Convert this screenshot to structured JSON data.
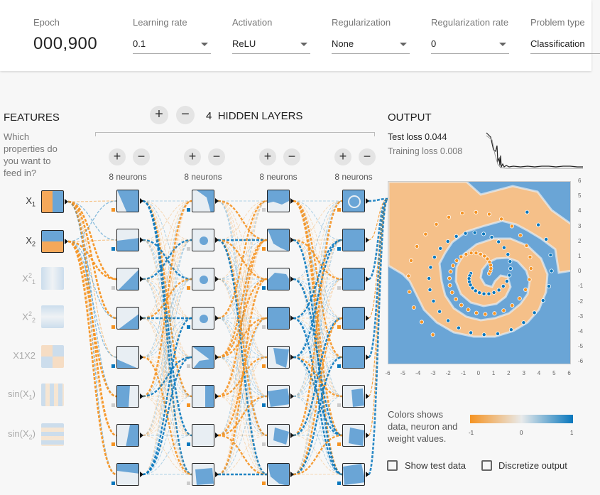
{
  "controls": {
    "epoch_label": "Epoch",
    "epoch_value": "000,900",
    "learning_rate": {
      "label": "Learning rate",
      "value": "0.1"
    },
    "activation": {
      "label": "Activation",
      "value": "ReLU"
    },
    "regularization": {
      "label": "Regularization",
      "value": "None"
    },
    "regularization_rate": {
      "label": "Regularization rate",
      "value": "0"
    },
    "problem_type": {
      "label": "Problem type",
      "value": "Classification"
    }
  },
  "features": {
    "title": "FEATURES",
    "question": [
      "Which",
      "properties do",
      "you want to",
      "feed in?"
    ],
    "items": [
      {
        "label": "X1",
        "base": "X",
        "sub": "1",
        "sup": "",
        "active": true
      },
      {
        "label": "X2",
        "base": "X",
        "sub": "2",
        "sup": "",
        "active": true
      },
      {
        "label": "X1²",
        "base": "X",
        "sub": "1",
        "sup": "2",
        "active": false
      },
      {
        "label": "X2²",
        "base": "X",
        "sub": "2",
        "sup": "2",
        "active": false
      },
      {
        "label": "X1X2",
        "base": "X1X2",
        "sub": "",
        "sup": "",
        "active": false
      },
      {
        "label": "sin(X1)",
        "base": "sin(X",
        "sub": "1",
        "sup": "",
        "active": false
      },
      {
        "label": "sin(X2)",
        "base": "sin(X",
        "sub": "2",
        "sup": "",
        "active": false
      }
    ]
  },
  "network": {
    "add_layer_label": "+",
    "remove_layer_label": "−",
    "layer_count": "4",
    "hidden_layers_label": "HIDDEN LAYERS",
    "layers": [
      {
        "add": "+",
        "remove": "−",
        "neurons_label": "8 neurons"
      },
      {
        "add": "+",
        "remove": "−",
        "neurons_label": "8 neurons"
      },
      {
        "add": "+",
        "remove": "−",
        "neurons_label": "8 neurons"
      },
      {
        "add": "+",
        "remove": "−",
        "neurons_label": "8 neurons"
      }
    ]
  },
  "output": {
    "title": "OUTPUT",
    "test_loss_label": "Test loss",
    "test_loss_value": "0.044",
    "training_loss_label": "Training loss",
    "training_loss_value": "0.008",
    "y_ticks": [
      "6",
      "5",
      "4",
      "3",
      "2",
      "1",
      "0",
      "-1",
      "-2",
      "-3",
      "-4",
      "-5",
      "-6"
    ],
    "x_ticks": [
      "-6",
      "-5",
      "-4",
      "-3",
      "-2",
      "-1",
      "0",
      "1",
      "2",
      "3",
      "4",
      "5",
      "6"
    ],
    "legend_text": [
      "Colors shows",
      "data, neuron and",
      "weight values."
    ],
    "legend_ticks": [
      "-1",
      "0",
      "1"
    ],
    "show_test_data_label": "Show test data",
    "discretize_output_label": "Discretize output",
    "show_test_data_checked": false,
    "discretize_output_checked": false
  },
  "colors": {
    "orange": "#f59322",
    "blue": "#0877bd",
    "light_blue": "#bcd6ec",
    "light_orange": "#f5c89a",
    "neutral": "#e8eaeb"
  }
}
